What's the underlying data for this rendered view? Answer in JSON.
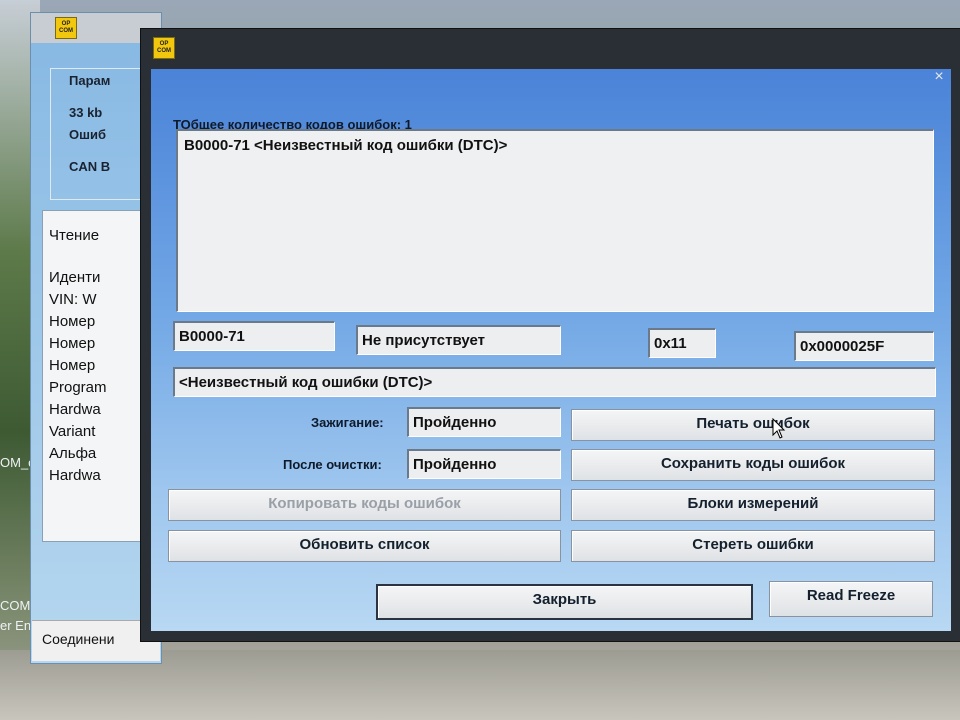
{
  "desktop": {
    "left_labels": [
      "OM_c",
      "COM",
      "er En"
    ]
  },
  "bg_window": {
    "icon_text": "OP COM",
    "group_lines": [
      "Парам",
      "33 kb",
      "Ошиб",
      "CAN B"
    ],
    "list_items": [
      "Чтение",
      "",
      "Иденти",
      "VIN: W",
      "Номер",
      "Номер",
      "Номер",
      "Program",
      "Hardwa",
      "Variant",
      "Альфа",
      "Hardwa"
    ],
    "status_text": "Соединени"
  },
  "main_window": {
    "icon_text": "OP COM",
    "close_glyph": "×",
    "error_count_label": "ТОбщее количество кодов ошибок: 1",
    "dtc_list": [
      "B0000-71 <Неизвестный код ошибки (DTC)>"
    ],
    "detail": {
      "code": "B0000-71",
      "status": "Не присутствует",
      "hex1": "0x11",
      "hex2": "0x0000025F",
      "description": "<Неизвестный код ошибки (DTC)>"
    },
    "ignition": {
      "label": "Зажигание:",
      "value": "Пройденно"
    },
    "after_clear": {
      "label": "После очистки:",
      "value": "Пройденно"
    },
    "buttons": {
      "print_errors": "Печать ошибок",
      "save_codes": "Сохранить коды ошибок",
      "copy_codes": "Копировать коды ошибок",
      "measuring_blocks": "Блоки измерений",
      "refresh_list": "Обновить список",
      "erase_errors": "Стереть ошибки",
      "close": "Закрыть",
      "read_freeze": "Read Freeze"
    }
  }
}
